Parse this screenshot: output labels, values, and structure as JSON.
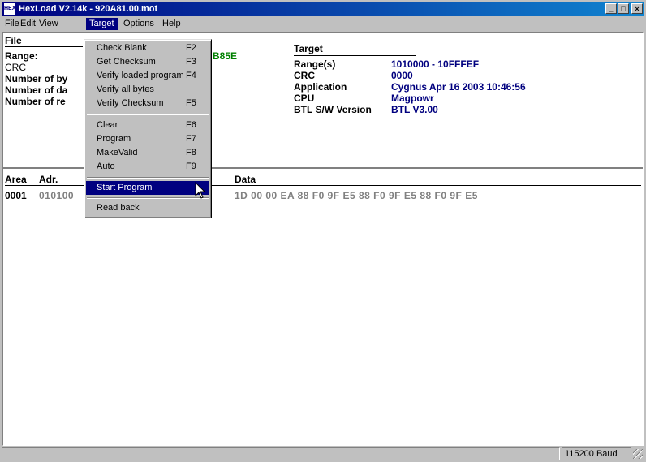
{
  "titlebar": {
    "icon_text": "HEX",
    "title": "HexLoad V2.14k - 920A81.00.mot",
    "min": "_",
    "max": "□",
    "close": "×"
  },
  "menubar": {
    "file": "File",
    "edit": "Edit",
    "view": "View",
    "target": "Target",
    "options": "Options",
    "help": "Help"
  },
  "file_panel": {
    "heading": "File",
    "range_label": "Range:",
    "crc_label": "CRC",
    "bytes_label": "Number of by",
    "data_label": "Number of da",
    "records_label": "Number of re",
    "crc_value_partial": "B85E"
  },
  "target_panel": {
    "heading": "Target",
    "rows": [
      {
        "label": "Range(s)",
        "value": "1010000 - 10FFFEF"
      },
      {
        "label": "CRC",
        "value": "0000"
      },
      {
        "label": "Application",
        "value": "Cygnus Apr 16 2003 10:46:56"
      },
      {
        "label": "CPU",
        "value": "Magpowr"
      },
      {
        "label": "BTL S/W Version",
        "value": "BTL V3.00"
      }
    ]
  },
  "table": {
    "col_area": "Area",
    "col_adr": "Adr.",
    "col_data": "Data",
    "row": {
      "area": "0001",
      "adr": "010100",
      "data": "1D 00 00 EA 88 F0 9F E5 88 F0 9F E5 88 F0 9F E5"
    }
  },
  "target_menu": {
    "items": [
      {
        "label": "Check Blank",
        "key": "F2"
      },
      {
        "label": "Get Checksum",
        "key": "F3"
      },
      {
        "label": "Verify loaded program",
        "key": "F4"
      },
      {
        "label": "Verify all bytes",
        "key": ""
      },
      {
        "label": "Verify Checksum",
        "key": "F5"
      },
      {
        "label": "Clear",
        "key": "F6"
      },
      {
        "label": "Program",
        "key": "F7"
      },
      {
        "label": "MakeValid",
        "key": "F8"
      },
      {
        "label": "Auto",
        "key": "F9"
      },
      {
        "label": "Start Program",
        "key": ""
      },
      {
        "label": "Read back",
        "key": ""
      }
    ]
  },
  "statusbar": {
    "baud": "115200 Baud"
  },
  "colors": {
    "title_active": "#000080",
    "value_blue": "#00007f",
    "value_green": "#008000",
    "selection": "#000080"
  }
}
